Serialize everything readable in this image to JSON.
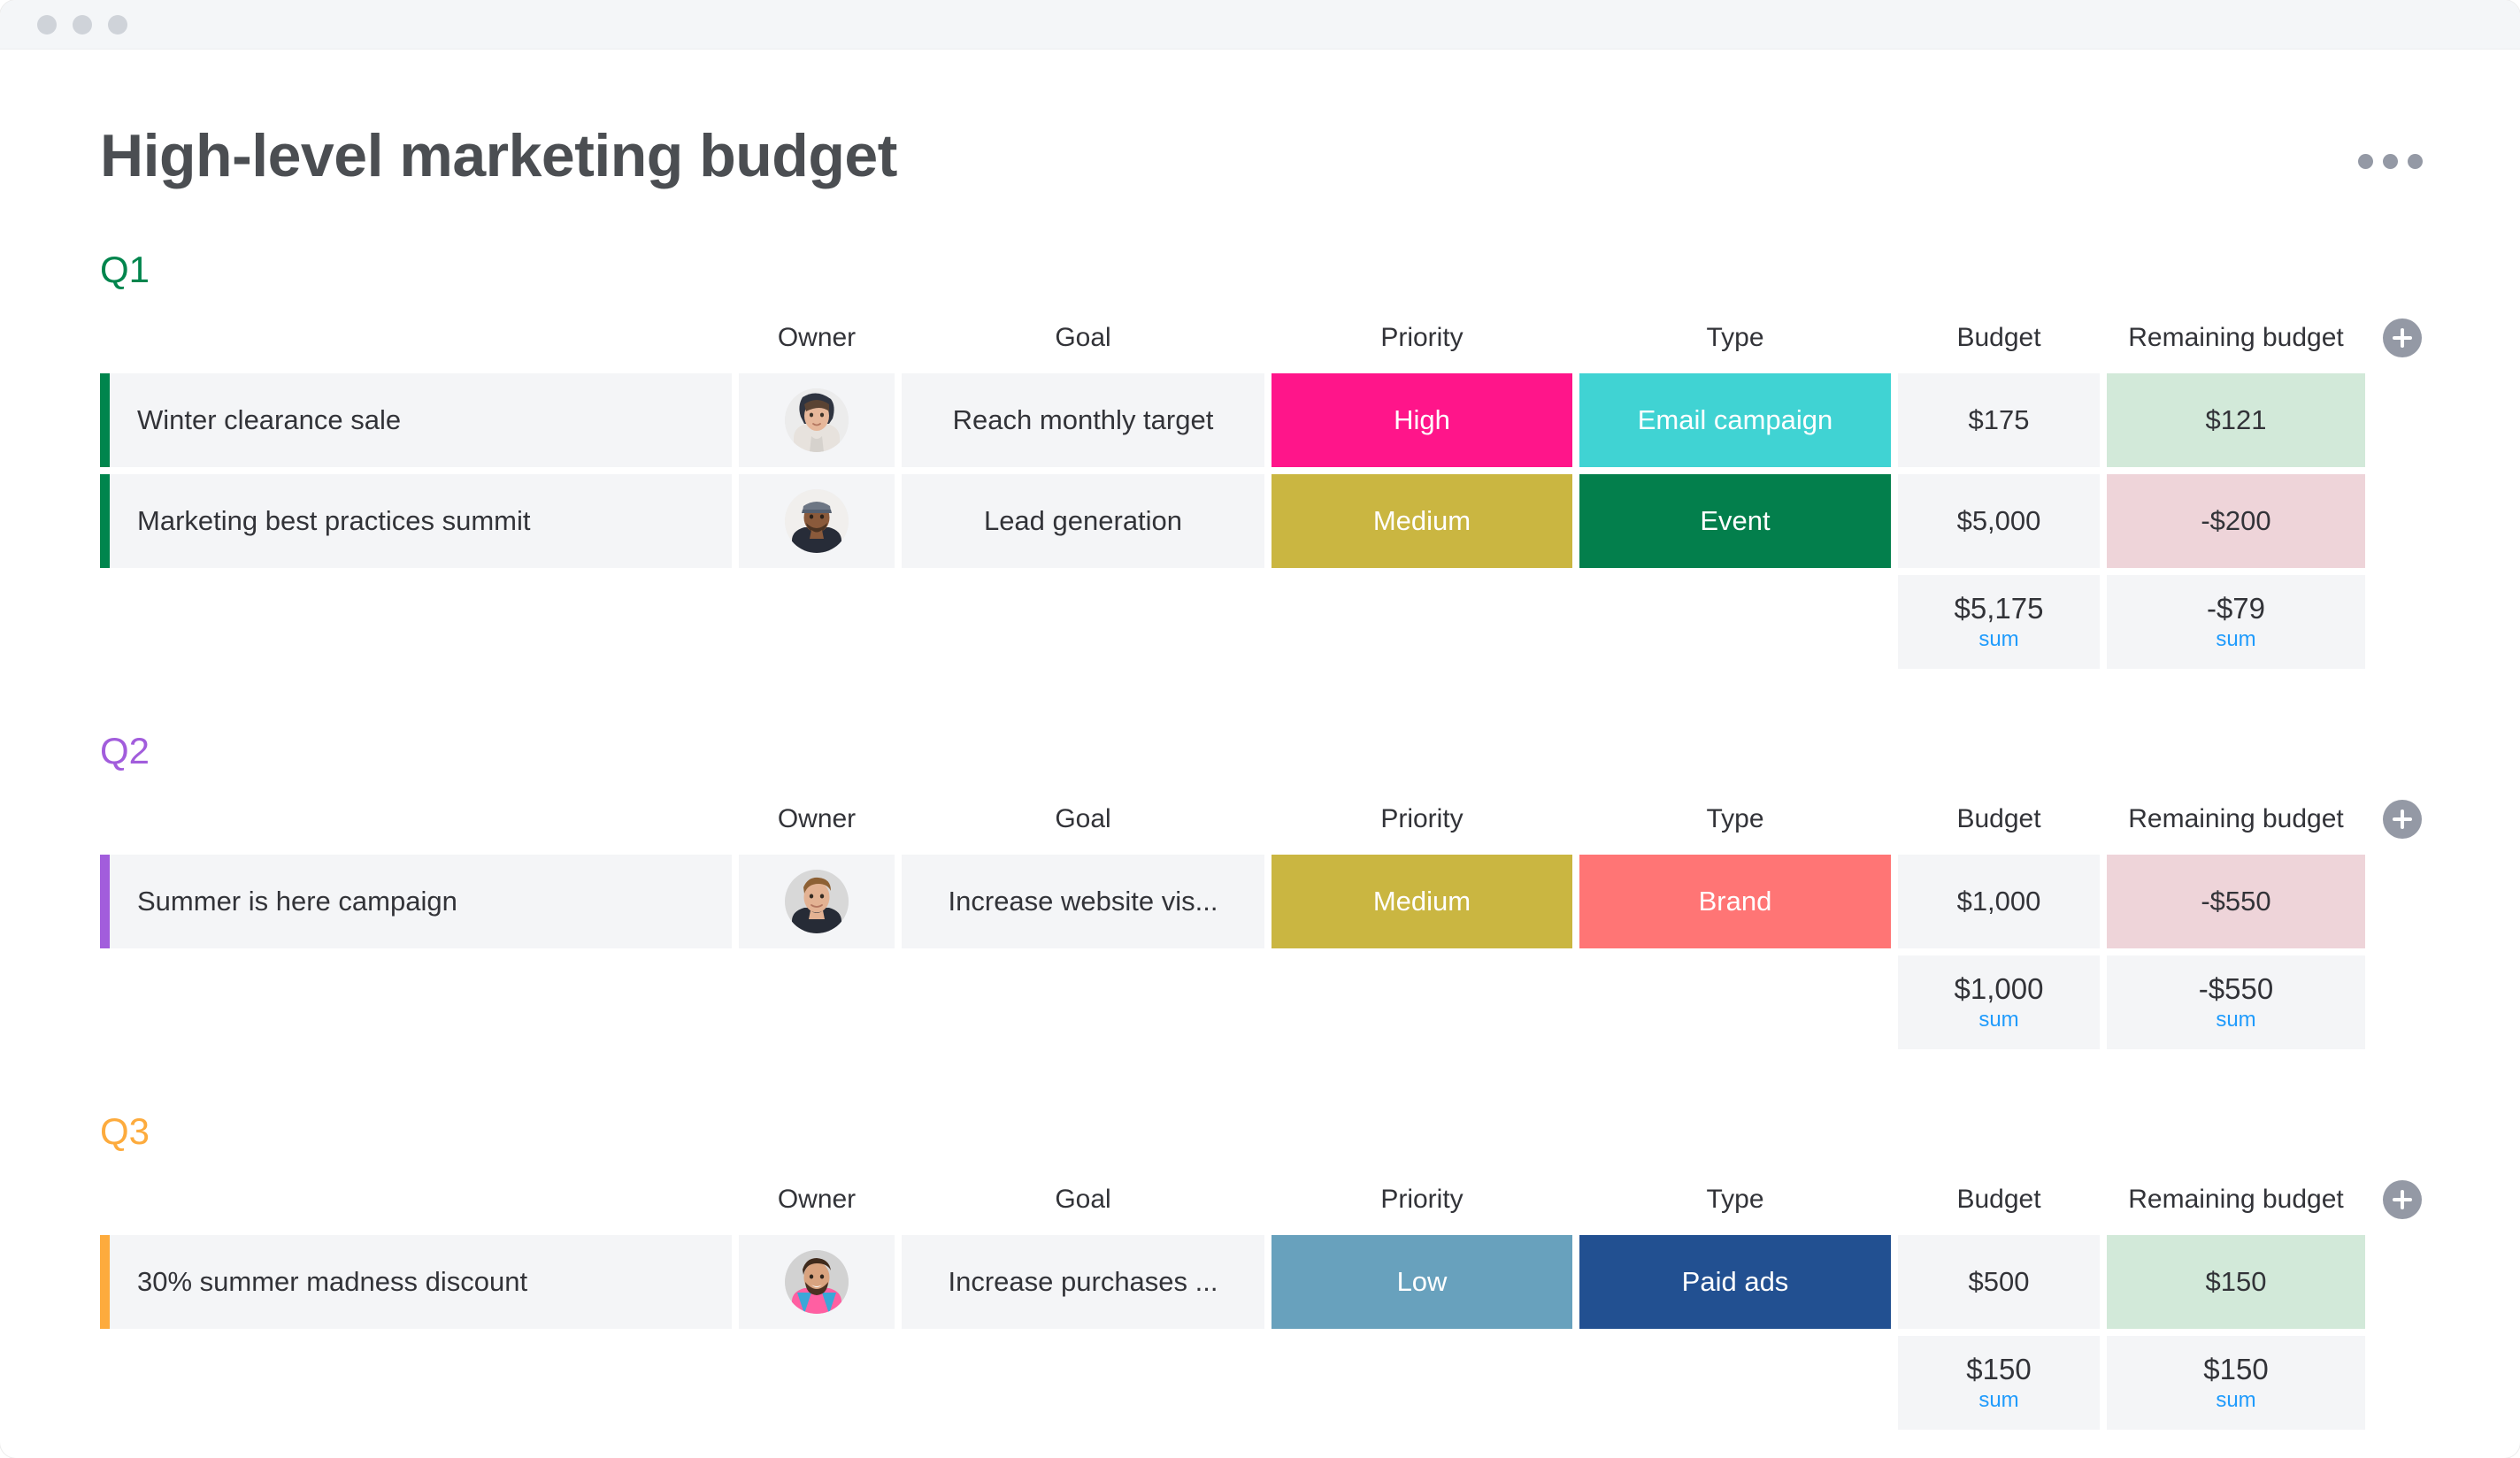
{
  "window": {
    "dots": [
      "dot-1",
      "dot-2",
      "dot-3"
    ]
  },
  "header": {
    "title": "High-level marketing budget",
    "menu_icon": "kebab-menu-icon"
  },
  "columns": [
    "Owner",
    "Goal",
    "Priority",
    "Type",
    "Budget",
    "Remaining budget"
  ],
  "add_column_label": "+",
  "colors": {
    "q1": "#00854d",
    "q2": "#a25ddc",
    "q3": "#fdab3d",
    "high": "#e2445c",
    "priority_high": "#ff158a",
    "priority_medium": "#cab641",
    "priority_low": "#68a1bd",
    "type_email": "#40d3d3",
    "type_event": "#037f4c",
    "type_brand": "#ff7575",
    "type_paid_ads": "#225091",
    "positive_bg": "#d2e9d9",
    "negative_bg": "#eed4d9",
    "sum_label": "#1f9bfc"
  },
  "groups": [
    {
      "title": "Q1",
      "color": "#00854d",
      "items": [
        {
          "name": "Winter clearance sale",
          "owner": "avatar-woman",
          "goal": "Reach monthly target",
          "priority": "High",
          "priority_color": "#ff158a",
          "type": "Email campaign",
          "type_color": "#40d3d3",
          "budget": "$175",
          "remaining": "$121",
          "remaining_state": "positive"
        },
        {
          "name": "Marketing best practices summit",
          "owner": "avatar-man-cap",
          "goal": "Lead generation",
          "priority": "Medium",
          "priority_color": "#cab641",
          "type": "Event",
          "type_color": "#037f4c",
          "budget": "$5,000",
          "remaining": "-$200",
          "remaining_state": "negative"
        }
      ],
      "summary": {
        "budget": "$5,175",
        "budget_label": "sum",
        "remaining": "-$79",
        "remaining_label": "sum"
      }
    },
    {
      "title": "Q2",
      "color": "#a25ddc",
      "items": [
        {
          "name": "Summer is here campaign",
          "owner": "avatar-man-short-hair",
          "goal": "Increase website vis...",
          "priority": "Medium",
          "priority_color": "#cab641",
          "type": "Brand",
          "type_color": "#ff7575",
          "budget": "$1,000",
          "remaining": "-$550",
          "remaining_state": "negative"
        }
      ],
      "summary": {
        "budget": "$1,000",
        "budget_label": "sum",
        "remaining": "-$550",
        "remaining_label": "sum"
      }
    },
    {
      "title": "Q3",
      "color": "#fdab3d",
      "items": [
        {
          "name": "30% summer madness discount",
          "owner": "avatar-man-beard",
          "goal": "Increase purchases ...",
          "priority": "Low",
          "priority_color": "#68a1bd",
          "type": "Paid ads",
          "type_color": "#225091",
          "budget": "$500",
          "remaining": "$150",
          "remaining_state": "positive"
        }
      ],
      "summary": {
        "budget": "$150",
        "budget_label": "sum",
        "remaining": "$150",
        "remaining_label": "sum"
      }
    }
  ]
}
